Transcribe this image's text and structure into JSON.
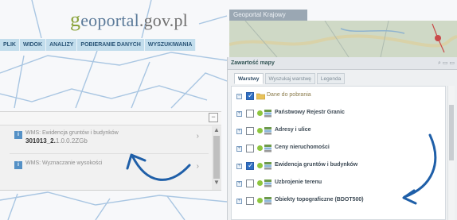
{
  "header": {
    "logo_g": "g",
    "logo_rest": "eoportal",
    "logo_tail": ".gov.pl",
    "basemap_label": "Geoportal Krajowy"
  },
  "menu": [
    {
      "label": "PLIK"
    },
    {
      "label": "WIDOK"
    },
    {
      "label": "ANALIZY"
    },
    {
      "label": "POBIERANIE DANYCH"
    },
    {
      "label": "WYSZUKIWANIA"
    }
  ],
  "results": {
    "collapse_glyph": "−",
    "items": [
      {
        "badge": "i",
        "title": "WMS: Ewidencja gruntów i budynków",
        "value": "301013_2.",
        "value_soft": "1.0.0.2ZGb",
        "chevron": "›"
      },
      {
        "badge": "i",
        "title": "WMS: Wyznaczanie wysokości",
        "value": "",
        "value_soft": "",
        "chevron": "›"
      }
    ],
    "scroll_up": "▲",
    "scroll_down": "▼"
  },
  "map_contents": {
    "title": "Zawartość mapy",
    "tools": "⌕ ▭ ▭",
    "tabs": [
      {
        "label": "Warstwy",
        "active": true
      },
      {
        "label": "Wyszukaj warstwę",
        "active": false
      },
      {
        "label": "Legenda",
        "active": false
      }
    ],
    "layers": [
      {
        "label": "Dane do pobrania",
        "checked": true,
        "type": "folder"
      },
      {
        "label": "Państwowy Rejestr Granic",
        "checked": false,
        "type": "layer"
      },
      {
        "label": "Adresy i ulice",
        "checked": false,
        "type": "layer"
      },
      {
        "label": "Ceny nieruchomości",
        "checked": false,
        "type": "layer"
      },
      {
        "label": "Ewidencja gruntów i budynków",
        "checked": true,
        "type": "layer"
      },
      {
        "label": "Uzbrojenie terenu",
        "checked": false,
        "type": "layer"
      },
      {
        "label": "Obiekty topograficzne (BDOT500)",
        "checked": false,
        "type": "layer"
      }
    ]
  },
  "colors": {
    "menu_bg": "#c2ddec",
    "accent_blue": "#2f6fc3",
    "arrow": "#1f5fa8",
    "layer_dot": "#8ec63f"
  }
}
